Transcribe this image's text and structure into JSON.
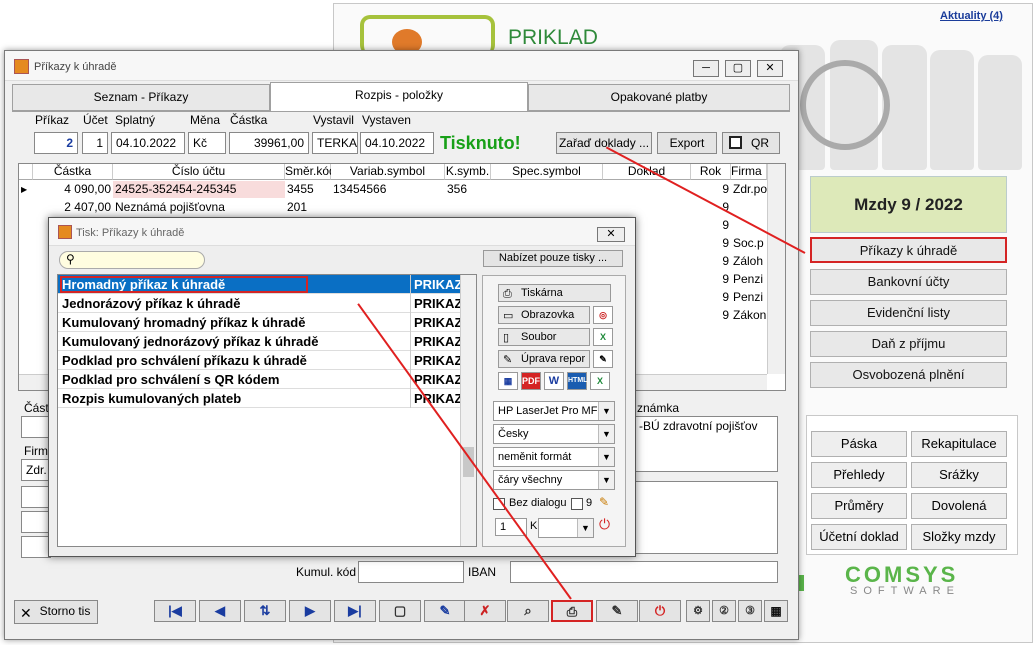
{
  "app": {
    "title": "PRIKLAD",
    "aktuality": "Aktuality (4)",
    "mzdy": "Mzdy  9 / 2022",
    "menu": [
      "Příkazy k úhradě",
      "Bankovní účty",
      "Evidenční listy",
      "Daň z příjmu",
      "Osvobozená plnění"
    ],
    "grid_buttons": [
      "Páska",
      "Rekapitulace",
      "Přehledy",
      "Srážky",
      "Průměry",
      "Dovolená",
      "Účetní doklad",
      "Složky mzdy"
    ],
    "comsys": "COMSYS",
    "software": "SOFTWARE"
  },
  "window": {
    "title": "Příkazy k úhradě",
    "tabs": [
      "Seznam - Příkazy",
      "Rozpis - položky",
      "Opakované platby"
    ],
    "labels": {
      "prikaz": "Příkaz",
      "ucet": "Účet",
      "splatny": "Splatný",
      "mena": "Měna",
      "castka": "Částka",
      "vystavil": "Vystavil",
      "vystaven": "Vystaven"
    },
    "values": {
      "prikaz": "2",
      "ucet": "1",
      "splatny": "04.10.2022",
      "mena": "Kč",
      "castka": "39961,00",
      "vystavil": "TERKA",
      "vystaven": "04.10.2022"
    },
    "status": "Tisknuto!",
    "btn_zarad": "Zařaď doklady ...",
    "btn_export": "Export",
    "btn_qr": "QR",
    "columns": [
      "Částka",
      "Číslo účtu",
      "Směr.kód",
      "Variab.symbol",
      "K.symb.",
      "Spec.symbol",
      "Doklad",
      "Rok",
      "Firma"
    ],
    "rows": [
      {
        "castka": "4 090,00",
        "ucet": "24525-352454-245345",
        "smer": "3455",
        "vs": "13454566",
        "ks": "356",
        "rok": "9",
        "firma": "Zdr.po"
      },
      {
        "castka": "2 407,00",
        "ucet": "Neznámá pojišťovna",
        "smer": "201",
        "vs": "",
        "ks": "",
        "rok": "9",
        "firma": ""
      }
    ],
    "extra_rows": [
      {
        "rok": "9",
        "firma": ""
      },
      {
        "rok": "9",
        "firma": "Soc.p"
      },
      {
        "rok": "9",
        "firma": "Záloh"
      },
      {
        "rok": "9",
        "firma": "Penzi"
      },
      {
        "rok": "9",
        "firma": "Penzi"
      },
      {
        "rok": "9",
        "firma": "Zákon"
      }
    ],
    "lower": {
      "cast": "Část",
      "firm": "Firm",
      "zdr": "Zdr.",
      "poznamka": "známka",
      "poznamka_text": "-BÚ zdravotní pojišťov",
      "kumul": "Kumul. kód",
      "iban": "IBAN"
    },
    "storno": "Storno tis"
  },
  "dialog": {
    "title": "Tisk: Příkazy k úhradě",
    "nabizet": "Nabízet pouze tisky ...",
    "reports": [
      {
        "name": "Hromadný příkaz k úhradě",
        "code": "PRIKAZ"
      },
      {
        "name": "Jednorázový příkaz k úhradě",
        "code": "PRIKAZ"
      },
      {
        "name": "Kumulovaný hromadný příkaz k úhradě",
        "code": "PRIKAZ"
      },
      {
        "name": "Kumulovaný jednorázový příkaz k úhradě",
        "code": "PRIKAZ"
      },
      {
        "name": "Podklad pro schválení příkazu k úhradě",
        "code": "PRIKAZ"
      },
      {
        "name": "Podklad pro schválení s QR kódem",
        "code": "PRIKAZ"
      },
      {
        "name": "Rozpis kumulovaných plateb",
        "code": "PRIKAZ"
      }
    ],
    "buttons": {
      "tiskarna": "Tiskárna",
      "obrazovka": "Obrazovka",
      "soubor": "Soubor",
      "uprava": "Úprava repor"
    },
    "formats": [
      "PDF",
      "W",
      "HTML",
      "X"
    ],
    "printer": "HP LaserJet Pro MFP",
    "lang": "Česky",
    "format": "neměnit formát",
    "lines": "čáry všechny",
    "bez_dialogu": "Bez dialogu",
    "nine": "9",
    "copies": "1",
    "k": "K"
  },
  "colors": {
    "accent": "#d42424",
    "green": "#18a018",
    "selection": "#0a6fc4"
  }
}
